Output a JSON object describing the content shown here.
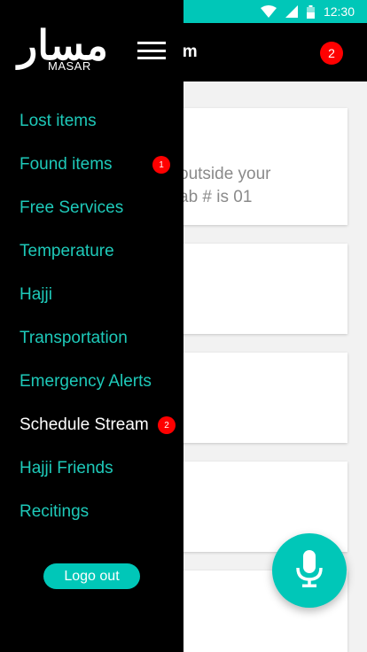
{
  "status_bar": {
    "time": "12:30",
    "icons": [
      "wifi-icon",
      "signal-icon",
      "battery-icon"
    ],
    "color": "#00c7b8"
  },
  "app_bar": {
    "title_visible_fragment": "am",
    "notification_count": "2"
  },
  "cards": [
    {
      "lines": [
        "outside your",
        "ab # is 01"
      ]
    },
    {
      "lines": []
    },
    {
      "lines": []
    },
    {
      "lines": []
    },
    {
      "lines": []
    }
  ],
  "fab": {
    "icon": "microphone-icon"
  },
  "drawer": {
    "logo": {
      "arabic": "مسار",
      "latin": "MASAR"
    },
    "menu_icon": "hamburger-icon",
    "items": [
      {
        "label": "Lost items",
        "badge": null,
        "active": false
      },
      {
        "label": "Found items",
        "badge": "1",
        "active": false
      },
      {
        "label": "Free Services",
        "badge": null,
        "active": false
      },
      {
        "label": "Temperature",
        "badge": null,
        "active": false
      },
      {
        "label": "Hajji",
        "badge": null,
        "active": false
      },
      {
        "label": "Transportation",
        "badge": null,
        "active": false
      },
      {
        "label": "Emergency Alerts",
        "badge": null,
        "active": false
      },
      {
        "label": "Schedule Stream",
        "badge": "2",
        "active": true
      },
      {
        "label": "Hajji Friends",
        "badge": null,
        "active": false
      },
      {
        "label": "Recitings",
        "badge": null,
        "active": false
      }
    ],
    "logout_label": "Logo out"
  },
  "colors": {
    "accent": "#00c7b8",
    "menu_text": "#1ec9b9",
    "badge": "#ff0000",
    "drawer_bg": "#000000"
  }
}
